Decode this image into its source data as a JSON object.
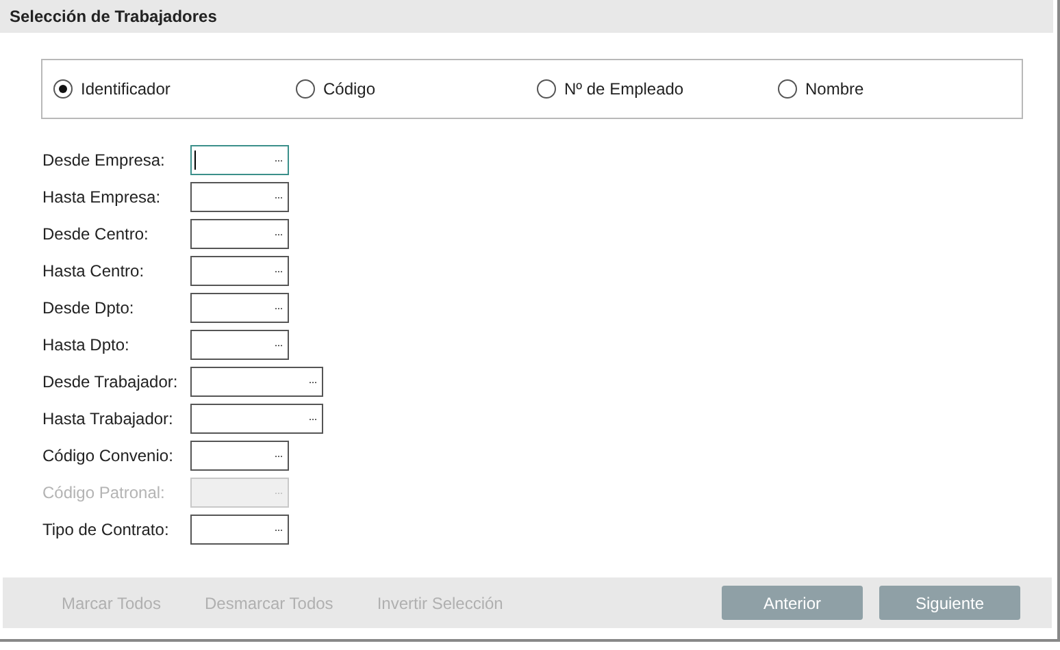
{
  "window": {
    "title": "Selección de Trabajadores"
  },
  "options": [
    {
      "label": "Identificador",
      "selected": true
    },
    {
      "label": "Código",
      "selected": false
    },
    {
      "label": "Nº de Empleado",
      "selected": false
    },
    {
      "label": "Nombre",
      "selected": false
    }
  ],
  "fields": [
    {
      "label": "Desde Empresa:",
      "kind": "short",
      "focused": true,
      "disabled": false,
      "browse": "···"
    },
    {
      "label": "Hasta Empresa:",
      "kind": "short",
      "focused": false,
      "disabled": false,
      "browse": "···"
    },
    {
      "label": "Desde Centro:",
      "kind": "short",
      "focused": false,
      "disabled": false,
      "browse": "···"
    },
    {
      "label": "Hasta Centro:",
      "kind": "short",
      "focused": false,
      "disabled": false,
      "browse": "···"
    },
    {
      "label": "Desde Dpto:",
      "kind": "short",
      "focused": false,
      "disabled": false,
      "browse": "···"
    },
    {
      "label": "Hasta Dpto:",
      "kind": "short",
      "focused": false,
      "disabled": false,
      "browse": "···"
    },
    {
      "label": "Desde Trabajador:",
      "kind": "long",
      "focused": false,
      "disabled": false,
      "browse": "···"
    },
    {
      "label": "Hasta Trabajador:",
      "kind": "long",
      "focused": false,
      "disabled": false,
      "browse": "···"
    },
    {
      "label": "Código Convenio:",
      "kind": "short",
      "focused": false,
      "disabled": false,
      "browse": "···"
    },
    {
      "label": "Código Patronal:",
      "kind": "short",
      "focused": false,
      "disabled": true,
      "browse": "···"
    },
    {
      "label": "Tipo de Contrato:",
      "kind": "short",
      "focused": false,
      "disabled": false,
      "browse": "···"
    }
  ],
  "footer": {
    "links": [
      {
        "label": "Marcar Todos",
        "disabled": true
      },
      {
        "label": "Desmarcar Todos",
        "disabled": true
      },
      {
        "label": "Invertir Selección",
        "disabled": true
      }
    ],
    "buttons": [
      {
        "label": "Anterior"
      },
      {
        "label": "Siguiente"
      }
    ]
  }
}
